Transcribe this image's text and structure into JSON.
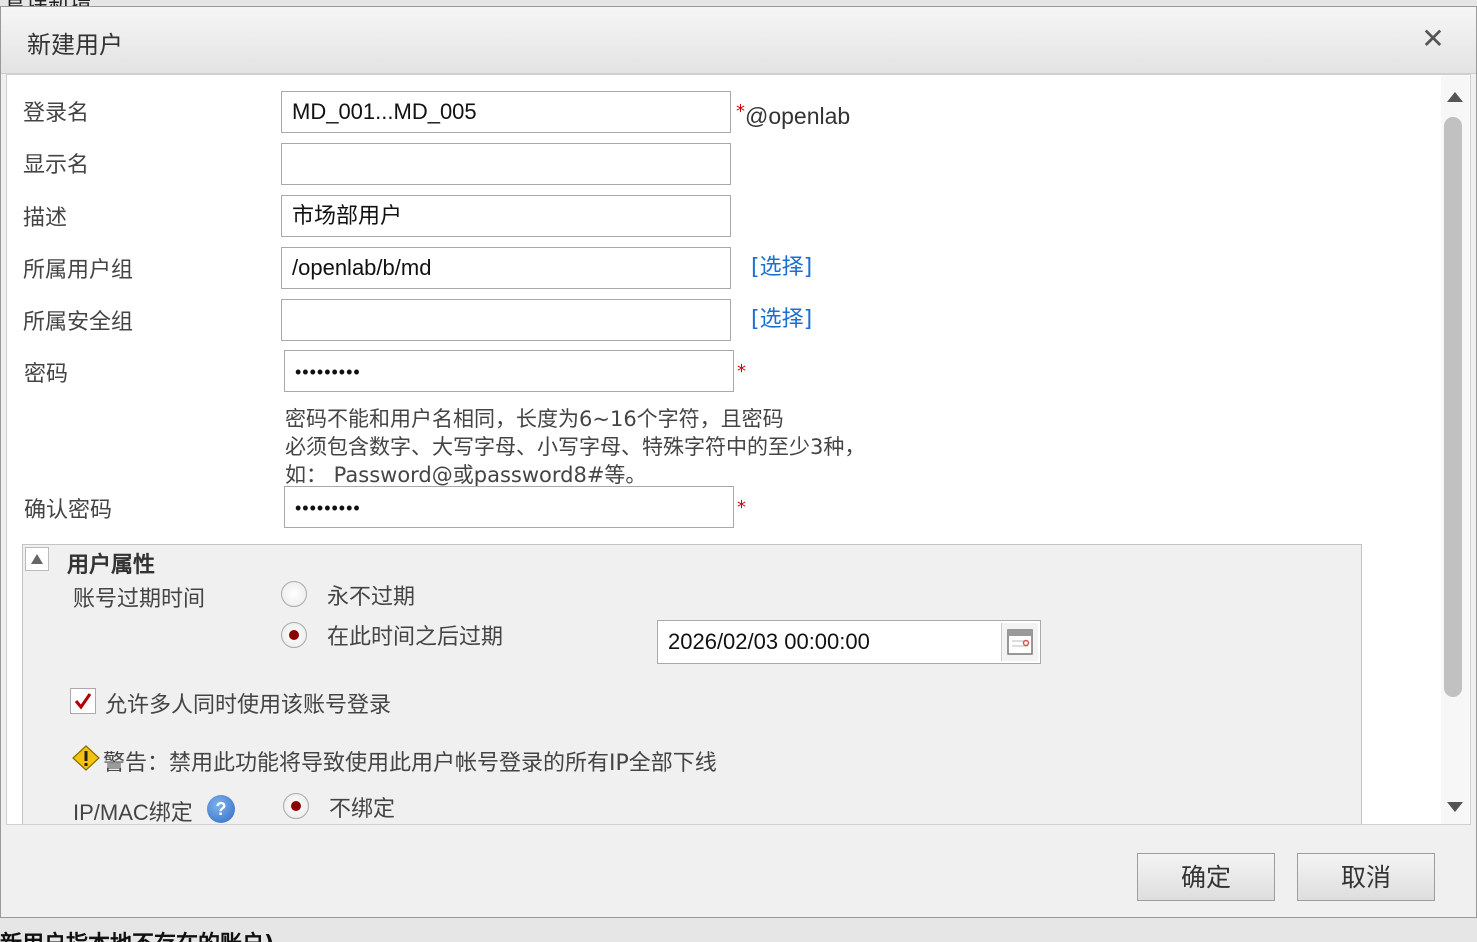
{
  "background": {
    "top_text": "管理新增",
    "bottom_text": "新用户指本地不存在的账户)"
  },
  "dialog": {
    "title": "新建用户",
    "close_icon": "close-icon"
  },
  "form": {
    "login_name": {
      "label": "登录名",
      "value": "MD_001...MD_005",
      "required": "*",
      "suffix": "@openlab"
    },
    "display_name": {
      "label": "显示名",
      "value": ""
    },
    "description": {
      "label": "描述",
      "value": "市场部用户"
    },
    "user_group": {
      "label": "所属用户组",
      "value": "/openlab/b/md",
      "select_link": "[选择]"
    },
    "security_group": {
      "label": "所属安全组",
      "value": "",
      "select_link": "[选择]"
    },
    "password": {
      "label": "密码",
      "value": "•••••••••",
      "required": "*"
    },
    "password_hint": {
      "line1": "密码不能和用户名相同，长度为6~16个字符，且密码",
      "line2": "必须包含数字、大写字母、小写字母、特殊字符中的至少3种，",
      "line3": "如： Password@或password8#等。"
    },
    "confirm_password": {
      "label": "确认密码",
      "value": "•••••••••",
      "required": "*"
    }
  },
  "user_attributes": {
    "title": "用户属性",
    "expiry_label": "账号过期时间",
    "never_expire": {
      "label": "永不过期",
      "selected": false
    },
    "expire_after": {
      "label": "在此时间之后过期",
      "selected": true
    },
    "expiry_datetime": "2026/02/03 00:00:00",
    "allow_multi_login": {
      "label": "允许多人同时使用该账号登录",
      "checked": true
    },
    "warning": "警告：禁用此功能将导致使用此用户帐号登录的所有IP全部下线",
    "ip_mac_label": "IP/MAC绑定",
    "ip_mac_help": "?",
    "no_bind": {
      "label": "不绑定",
      "selected": true
    }
  },
  "buttons": {
    "ok": "确定",
    "cancel": "取消"
  },
  "colors": {
    "link": "#1b6fd1",
    "required": "#d40000",
    "radio_selected": "#8b0000"
  }
}
